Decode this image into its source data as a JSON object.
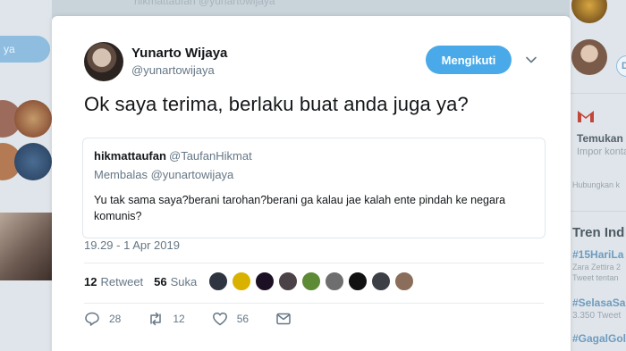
{
  "background": {
    "left_pill_label": "ya",
    "top_blur_text": "hikmattaufan  @yunartowijaya",
    "right": {
      "suggest_letter": "D",
      "promo_title": "Temukan",
      "promo_sub": "Impor konta",
      "connect_text": "Hubungkan k",
      "trends_heading": "Tren Ind",
      "trends": [
        {
          "tag": "#15HariLa",
          "sub": "Zara Zettira 2",
          "sub2": "Tweet tentan"
        },
        {
          "tag": "#SelasaSan",
          "sub": "3.350 Tweet"
        },
        {
          "tag": "#GagalGol",
          "sub": ""
        }
      ]
    }
  },
  "tweet": {
    "author_name": "Yunarto Wijaya",
    "author_handle": "@yunartowijaya",
    "follow_label": "Mengikuti",
    "caret_icon": "chevron-down-icon",
    "text": "Ok saya terima, berlaku buat anda juga ya?",
    "quoted": {
      "name": "hikmattaufan",
      "handle": "@TaufanHikmat",
      "reply_prefix": "Membalas",
      "reply_handle": "@yunartowijaya",
      "text": "Yu tak sama saya?berani tarohan?berani ga kalau jae kalah ente pindah ke negara komunis?"
    },
    "timestamp": "19.29 - 1 Apr 2019",
    "stats": {
      "retweet_count": "12",
      "retweet_label": "Retweet",
      "like_count": "56",
      "like_label": "Suka"
    },
    "likers": [
      {
        "color": "#2e3540"
      },
      {
        "color": "#d9b200"
      },
      {
        "color": "#1c1024"
      },
      {
        "color": "#4a4246"
      },
      {
        "color": "#5d8a35"
      },
      {
        "color": "#6e6e6e"
      },
      {
        "color": "#111111"
      },
      {
        "color": "#3c3f45"
      },
      {
        "color": "#8a6d5a"
      }
    ],
    "actions": {
      "reply_count": "28",
      "retweet_count": "12",
      "like_count": "56"
    }
  }
}
